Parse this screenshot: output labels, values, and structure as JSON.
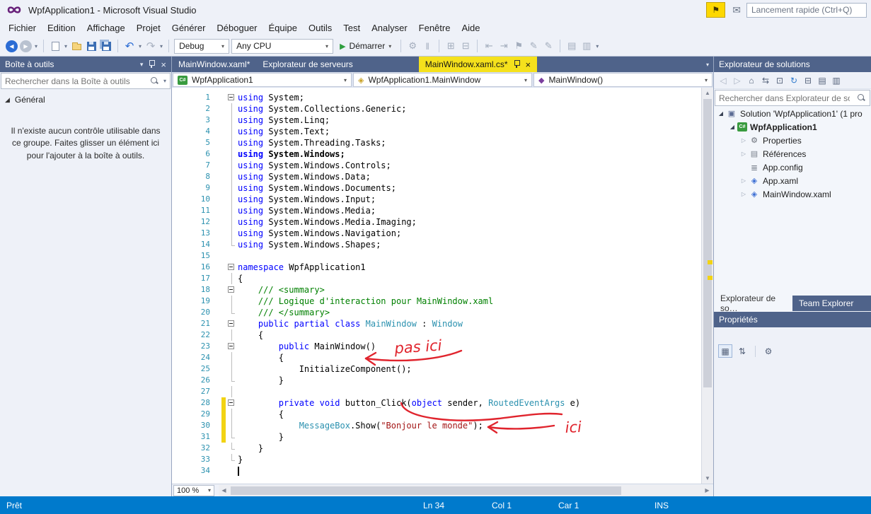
{
  "colors": {
    "accent": "#007acc",
    "panel_header": "#4f638a",
    "active_tab": "#f5e11c",
    "annotation_red": "#e0242d",
    "keyword": "#0000ff",
    "type": "#2b91af",
    "string": "#a31515",
    "comment": "#008000",
    "line_number": "#2b91af",
    "changed_line_marker": "#f2d313"
  },
  "title_bar": {
    "app_title": "WpfApplication1 - Microsoft Visual Studio",
    "quick_launch_placeholder": "Lancement rapide (Ctrl+Q)"
  },
  "menu_bar": {
    "items": [
      "Fichier",
      "Edition",
      "Affichage",
      "Projet",
      "Générer",
      "Déboguer",
      "Équipe",
      "Outils",
      "Test",
      "Analyser",
      "Fenêtre",
      "Aide"
    ]
  },
  "toolbar": {
    "debug_target": "Debug",
    "platform": "Any CPU",
    "start_button": "Démarrer"
  },
  "toolbox": {
    "title": "Boîte à outils",
    "search_placeholder": "Rechercher dans la Boîte à outils",
    "section_label": "Général",
    "empty_message": "Il n'existe aucun contrôle utilisable dans ce groupe. Faites glisser un élément ici pour l'ajouter à la boîte à outils."
  },
  "editor": {
    "tabs": [
      {
        "label": "MainWindow.xaml*",
        "active": false
      },
      {
        "label": "Explorateur de serveurs",
        "active": false
      },
      {
        "label": "MainWindow.xaml.cs*",
        "active": true
      }
    ],
    "navigation": {
      "project": "WpfApplication1",
      "type": "WpfApplication1.MainWindow",
      "member": "MainWindow()"
    },
    "zoom": "100 %",
    "code": [
      {
        "n": 1,
        "f": "b",
        "s": [
          [
            "kw",
            "using"
          ],
          [
            "pl",
            " System;"
          ]
        ]
      },
      {
        "n": 2,
        "f": "l",
        "s": [
          [
            "kw",
            "using"
          ],
          [
            "pl",
            " System.Collections.Generic;"
          ]
        ]
      },
      {
        "n": 3,
        "f": "l",
        "s": [
          [
            "kw",
            "using"
          ],
          [
            "pl",
            " System.Linq;"
          ]
        ]
      },
      {
        "n": 4,
        "f": "l",
        "s": [
          [
            "kw",
            "using"
          ],
          [
            "pl",
            " System.Text;"
          ]
        ]
      },
      {
        "n": 5,
        "f": "l",
        "s": [
          [
            "kw",
            "using"
          ],
          [
            "pl",
            " System.Threading.Tasks;"
          ]
        ]
      },
      {
        "n": 6,
        "f": "l",
        "bold": true,
        "s": [
          [
            "kw",
            "using"
          ],
          [
            "pl",
            " System.Windows;"
          ]
        ]
      },
      {
        "n": 7,
        "f": "l",
        "s": [
          [
            "kw",
            "using"
          ],
          [
            "pl",
            " System.Windows.Controls;"
          ]
        ]
      },
      {
        "n": 8,
        "f": "l",
        "s": [
          [
            "kw",
            "using"
          ],
          [
            "pl",
            " System.Windows.Data;"
          ]
        ]
      },
      {
        "n": 9,
        "f": "l",
        "s": [
          [
            "kw",
            "using"
          ],
          [
            "pl",
            " System.Windows.Documents;"
          ]
        ]
      },
      {
        "n": 10,
        "f": "l",
        "s": [
          [
            "kw",
            "using"
          ],
          [
            "pl",
            " System.Windows.Input;"
          ]
        ]
      },
      {
        "n": 11,
        "f": "l",
        "s": [
          [
            "kw",
            "using"
          ],
          [
            "pl",
            " System.Windows.Media;"
          ]
        ]
      },
      {
        "n": 12,
        "f": "l",
        "s": [
          [
            "kw",
            "using"
          ],
          [
            "pl",
            " System.Windows.Media.Imaging;"
          ]
        ]
      },
      {
        "n": 13,
        "f": "l",
        "s": [
          [
            "kw",
            "using"
          ],
          [
            "pl",
            " System.Windows.Navigation;"
          ]
        ]
      },
      {
        "n": 14,
        "f": "e",
        "s": [
          [
            "kw",
            "using"
          ],
          [
            "pl",
            " System.Windows.Shapes;"
          ]
        ]
      },
      {
        "n": 15,
        "f": "",
        "s": []
      },
      {
        "n": 16,
        "f": "b",
        "s": [
          [
            "kw",
            "namespace"
          ],
          [
            "pl",
            " WpfApplication1"
          ]
        ]
      },
      {
        "n": 17,
        "f": "l",
        "s": [
          [
            "pl",
            "{"
          ]
        ]
      },
      {
        "n": 18,
        "f": "b",
        "s": [
          [
            "cm",
            "    /// <summary>"
          ]
        ]
      },
      {
        "n": 19,
        "f": "l",
        "s": [
          [
            "cm",
            "    /// Logique d'interaction pour MainWindow.xaml"
          ]
        ]
      },
      {
        "n": 20,
        "f": "e",
        "s": [
          [
            "cm",
            "    /// </summary>"
          ]
        ]
      },
      {
        "n": 21,
        "f": "b",
        "s": [
          [
            "pl",
            "    "
          ],
          [
            "kw",
            "public partial class"
          ],
          [
            "pl",
            " "
          ],
          [
            "ty",
            "MainWindow"
          ],
          [
            "pl",
            " : "
          ],
          [
            "ty",
            "Window"
          ]
        ]
      },
      {
        "n": 22,
        "f": "l",
        "s": [
          [
            "pl",
            "    {"
          ]
        ]
      },
      {
        "n": 23,
        "f": "b",
        "s": [
          [
            "pl",
            "        "
          ],
          [
            "kw",
            "public"
          ],
          [
            "pl",
            " MainWindow()"
          ]
        ]
      },
      {
        "n": 24,
        "f": "l",
        "s": [
          [
            "pl",
            "        {"
          ]
        ]
      },
      {
        "n": 25,
        "f": "l",
        "s": [
          [
            "pl",
            "            InitializeComponent();"
          ]
        ]
      },
      {
        "n": 26,
        "f": "e",
        "s": [
          [
            "pl",
            "        }"
          ]
        ]
      },
      {
        "n": 27,
        "f": "l",
        "s": []
      },
      {
        "n": 28,
        "f": "b",
        "chg": true,
        "s": [
          [
            "pl",
            "        "
          ],
          [
            "kw",
            "private"
          ],
          [
            "pl",
            " "
          ],
          [
            "kw",
            "void"
          ],
          [
            "pl",
            " button_Click("
          ],
          [
            "kw",
            "object"
          ],
          [
            "pl",
            " sender, "
          ],
          [
            "ty",
            "RoutedEventArgs"
          ],
          [
            "pl",
            " e)"
          ]
        ]
      },
      {
        "n": 29,
        "f": "l",
        "chg": true,
        "s": [
          [
            "pl",
            "        {"
          ]
        ]
      },
      {
        "n": 30,
        "f": "l",
        "chg": true,
        "s": [
          [
            "pl",
            "            "
          ],
          [
            "ty",
            "MessageBox"
          ],
          [
            "pl",
            ".Show("
          ],
          [
            "st",
            "\"Bonjour le monde\""
          ],
          [
            "pl",
            ");"
          ]
        ]
      },
      {
        "n": 31,
        "f": "e",
        "chg": true,
        "s": [
          [
            "pl",
            "        }"
          ]
        ]
      },
      {
        "n": 32,
        "f": "e",
        "s": [
          [
            "pl",
            "    }"
          ]
        ]
      },
      {
        "n": 33,
        "f": "e",
        "s": [
          [
            "pl",
            "}"
          ]
        ]
      },
      {
        "n": 34,
        "f": "",
        "caret": true,
        "s": []
      }
    ]
  },
  "annotations": {
    "note_top": "pas ici",
    "note_bottom": "ici"
  },
  "solution_explorer": {
    "title": "Explorateur de solutions",
    "search_placeholder": "Rechercher dans Explorateur de solu",
    "tree": [
      {
        "label": "Solution 'WpfApplication1' (1 pro",
        "icon": "solution",
        "indent": 0,
        "expander": "expanded",
        "bold": false
      },
      {
        "label": "WpfApplication1",
        "icon": "csharp-project",
        "indent": 1,
        "expander": "expanded",
        "bold": true
      },
      {
        "label": "Properties",
        "icon": "properties",
        "indent": 2,
        "expander": "collapsed",
        "bold": false
      },
      {
        "label": "Références",
        "icon": "references",
        "indent": 2,
        "expander": "collapsed",
        "bold": false
      },
      {
        "label": "App.config",
        "icon": "config-file",
        "indent": 2,
        "expander": "none",
        "bold": false
      },
      {
        "label": "App.xaml",
        "icon": "xaml-file",
        "indent": 2,
        "expander": "collapsed",
        "bold": false
      },
      {
        "label": "MainWindow.xaml",
        "icon": "xaml-file",
        "indent": 2,
        "expander": "collapsed",
        "bold": false
      }
    ],
    "bottom_tabs": [
      {
        "label": "Explorateur de so…",
        "active": true
      },
      {
        "label": "Team Explorer",
        "active": false
      }
    ]
  },
  "properties_panel": {
    "title": "Propriétés"
  },
  "status_bar": {
    "state": "Prêt",
    "line": "Ln 34",
    "column": "Col 1",
    "character": "Car 1",
    "insert_mode": "INS"
  },
  "icons": {
    "close": "×",
    "dropdown": "▾",
    "nav_back": "◀",
    "nav_forward": "▶",
    "undo": "↶",
    "redo": "↷",
    "play": "▶",
    "expanded": "◢",
    "collapsed": "▷",
    "home": "⌂",
    "refresh": "↻",
    "collapse_all": "⊟",
    "sync_selection": "⇆",
    "pending": "⊡",
    "properties_view": "▤",
    "preview": "▥",
    "back_small": "◁",
    "forward_small": "▷",
    "scroll_up": "▲",
    "scroll_down": "▼",
    "scroll_left": "◀",
    "scroll_right": "▶",
    "flag": "⚑",
    "feedback": "✉",
    "categorized": "▦",
    "alphabetical": "⇅",
    "events": "⚙",
    "attach": "⚙",
    "break_all": "‖",
    "new_window": "⊞",
    "split_window": "⊟",
    "indent_dec": "⇤",
    "indent_inc": "⇥",
    "bookmark": "⚑",
    "comment": "✎",
    "uncomment": "✎",
    "misc_a": "▤",
    "misc_b": "▥",
    "csharp_project": "C#",
    "class": "◈",
    "method": "◆",
    "search": "css:magnifier",
    "pin": "css:pin",
    "save": "css:floppy",
    "save_all": "css:floppy-stack",
    "new_file": "css:document",
    "open_file": "css:folder",
    "vs_logo": "css:infinity",
    "tree": {
      "solution": "▣",
      "csharp-project": "C#",
      "properties": "⚙",
      "references": "▤",
      "config-file": "≣",
      "xaml-file": "◈"
    }
  }
}
